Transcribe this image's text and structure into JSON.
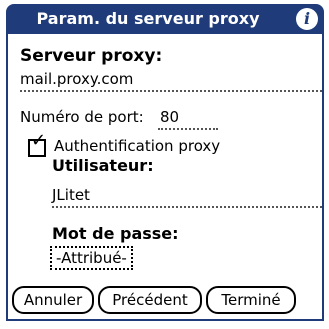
{
  "colors": {
    "title_bar": "#1f3b79",
    "title_text": "#ffffff",
    "text": "#000000",
    "background": "#ffffff"
  },
  "header": {
    "title": "Param. du serveur proxy",
    "info_icon": "info-icon"
  },
  "form": {
    "proxy_server_label": "Serveur proxy:",
    "proxy_server_value": "mail.proxy.com",
    "port_label": "Numéro de port:",
    "port_value": "80",
    "auth_checkbox_label": "Authentification proxy",
    "auth_checked": true,
    "user_label": "Utilisateur:",
    "user_value": "JLitet",
    "password_label": "Mot de passe:",
    "password_value": "-Attribué-"
  },
  "buttons": {
    "cancel": "Annuler",
    "previous": "Précédent",
    "done": "Terminé"
  }
}
